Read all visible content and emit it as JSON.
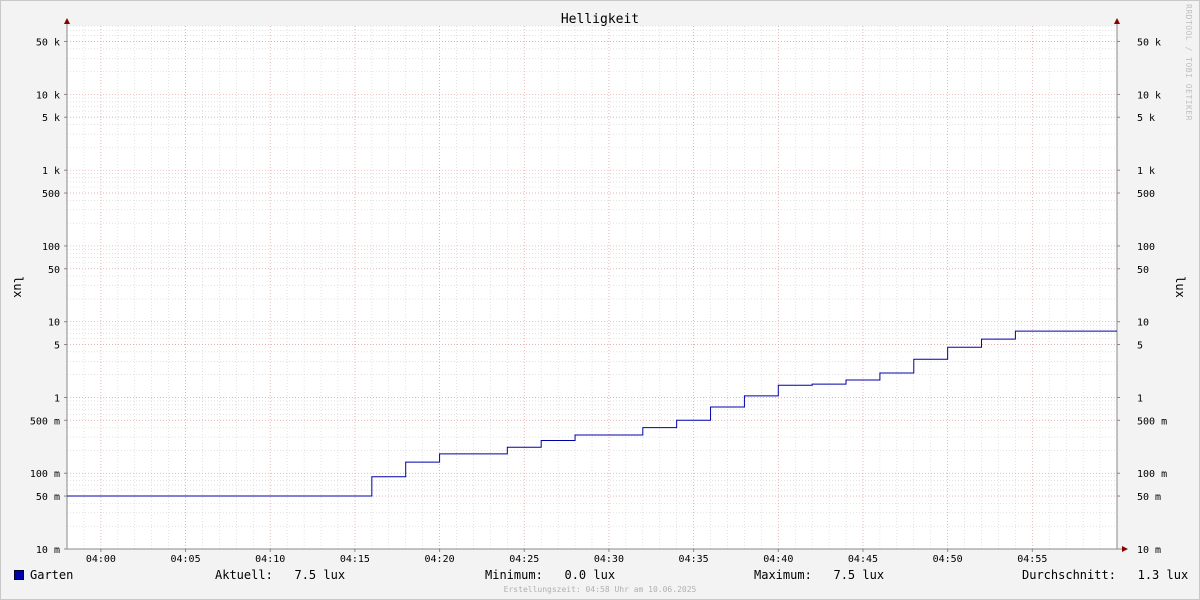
{
  "chart_data": {
    "type": "line",
    "title": "Helligkeit",
    "ylabel": "lux",
    "yscale": "log",
    "ylim": [
      0.01,
      80000
    ],
    "xlim": [
      "03:58:00",
      "05:00:00"
    ],
    "x_ticks": [
      "04:00",
      "04:05",
      "04:10",
      "04:15",
      "04:20",
      "04:25",
      "04:30",
      "04:35",
      "04:40",
      "04:45",
      "04:50",
      "04:55"
    ],
    "y_ticks": [
      {
        "value": 50000,
        "label": "50 k"
      },
      {
        "value": 10000,
        "label": "10 k"
      },
      {
        "value": 5000,
        "label": "5 k"
      },
      {
        "value": 1000,
        "label": "1 k"
      },
      {
        "value": 500,
        "label": "500"
      },
      {
        "value": 100,
        "label": "100"
      },
      {
        "value": 50,
        "label": "50"
      },
      {
        "value": 10,
        "label": "10"
      },
      {
        "value": 5,
        "label": "5"
      },
      {
        "value": 1,
        "label": "1"
      },
      {
        "value": 0.5,
        "label": "500 m"
      },
      {
        "value": 0.1,
        "label": "100 m"
      },
      {
        "value": 0.05,
        "label": "50 m"
      },
      {
        "value": 0.01,
        "label": "10 m"
      }
    ],
    "grid": true,
    "legend_position": "bottom",
    "series": [
      {
        "name": "Garten",
        "color": "#0000aa",
        "interpolation": "step",
        "x": [
          "03:58:00",
          "04:16:00",
          "04:18:00",
          "04:20:00",
          "04:24:00",
          "04:26:00",
          "04:28:00",
          "04:32:00",
          "04:34:00",
          "04:36:00",
          "04:38:00",
          "04:40:00",
          "04:42:00",
          "04:44:00",
          "04:46:00",
          "04:48:00",
          "04:50:00",
          "04:52:00",
          "04:54:00",
          "05:00:00"
        ],
        "values": [
          0.05,
          0.09,
          0.14,
          0.18,
          0.22,
          0.27,
          0.32,
          0.4,
          0.5,
          0.75,
          1.05,
          1.45,
          1.5,
          1.7,
          2.1,
          3.2,
          4.6,
          5.9,
          7.5,
          7.5
        ]
      }
    ]
  },
  "legend": {
    "series_name": "Garten",
    "current": "Aktuell:   7.5 lux",
    "minimum": "Minimum:   0.0 lux",
    "maximum": "Maximum:   7.5 lux",
    "average": "Durchschnitt:   1.3 lux"
  },
  "footer": "Erstellungszeit: 04:58 Uhr am 10.06.2025",
  "watermark": "RRDTOOL / TOBI OETIKER",
  "colors": {
    "series": "#0000aa",
    "major_grid": "#e8a0a0",
    "minor_grid": "#d0d0d0",
    "axis": "#888888",
    "arrow": "#880000"
  }
}
